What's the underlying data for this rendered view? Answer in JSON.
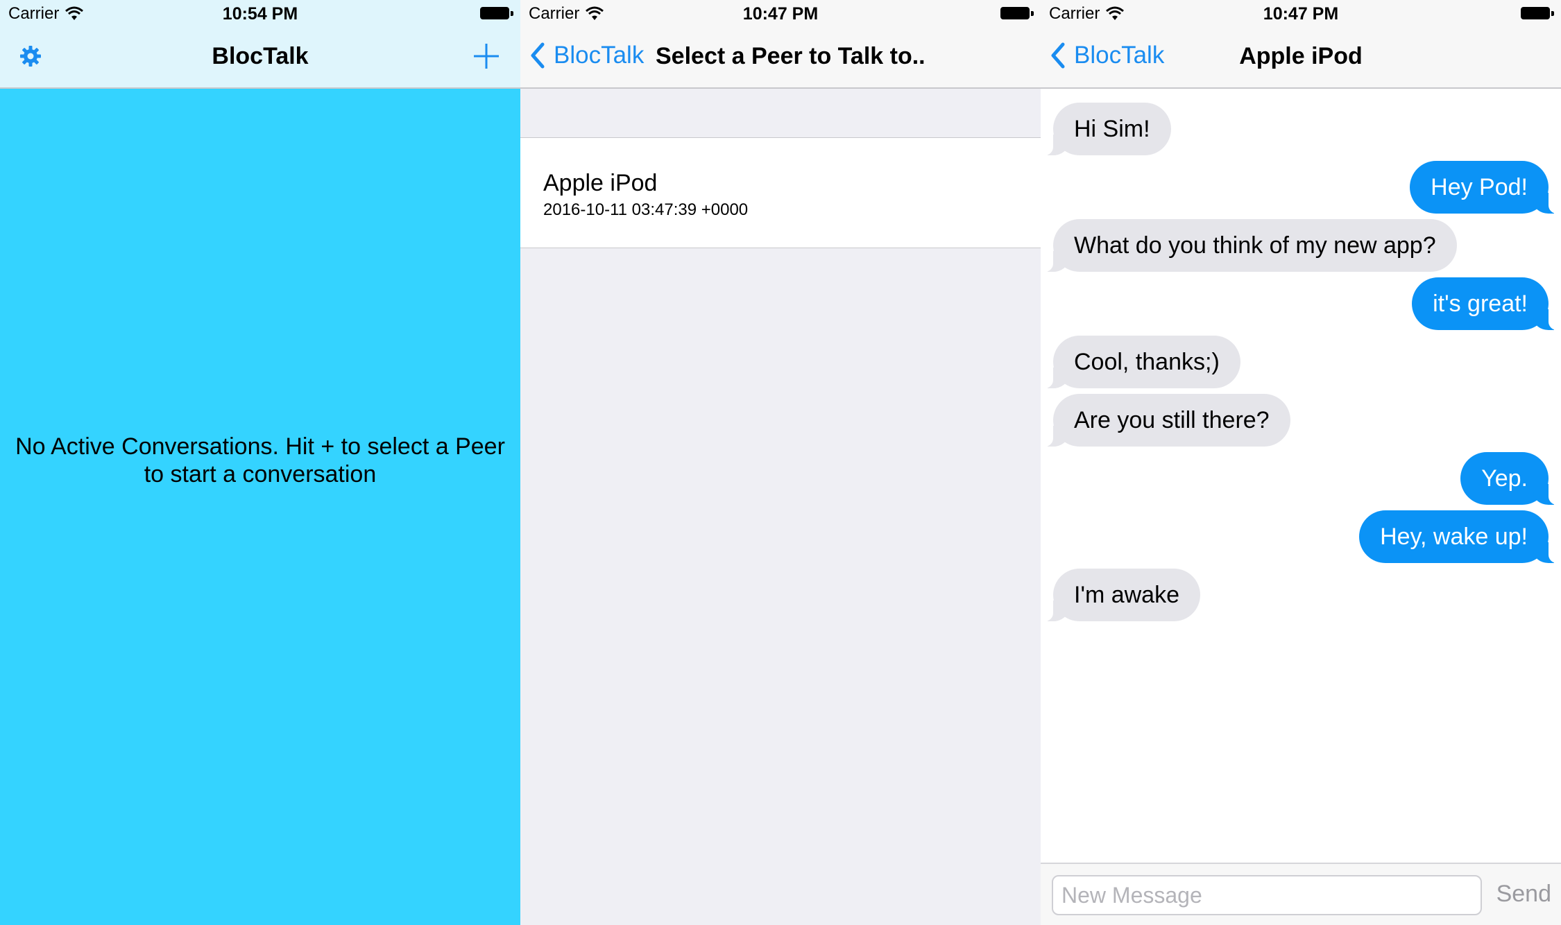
{
  "screens": [
    {
      "status": {
        "carrier": "Carrier",
        "time": "10:54 PM"
      },
      "nav": {
        "title": "BlocTalk",
        "left_icon": "gear-icon",
        "right_icon": "plus-icon"
      },
      "empty_message_line1": "No Active Conversations.  Hit + to select a Peer",
      "empty_message_line2": "to start a conversation",
      "colors": {
        "background": "#34d3ff",
        "navbar": "#dff5fc",
        "tint": "#1a8cf0"
      }
    },
    {
      "status": {
        "carrier": "Carrier",
        "time": "10:47 PM"
      },
      "nav": {
        "back_label": "BlocTalk",
        "title": "Select a Peer to Talk to.."
      },
      "peers": [
        {
          "name": "Apple iPod",
          "date": "2016-10-11 03:47:39 +0000"
        }
      ],
      "colors": {
        "background": "#efeff4"
      }
    },
    {
      "status": {
        "carrier": "Carrier",
        "time": "10:47 PM"
      },
      "nav": {
        "back_label": "BlocTalk",
        "title": "Apple iPod"
      },
      "messages": [
        {
          "text": "Hi Sim!",
          "direction": "incoming"
        },
        {
          "text": "Hey Pod!",
          "direction": "outgoing"
        },
        {
          "text": "What do you think of my new app?",
          "direction": "incoming"
        },
        {
          "text": "it's great!",
          "direction": "outgoing"
        },
        {
          "text": "Cool, thanks;)",
          "direction": "incoming"
        },
        {
          "text": "Are you still there?",
          "direction": "incoming"
        },
        {
          "text": "Yep.",
          "direction": "outgoing"
        },
        {
          "text": "Hey, wake up!",
          "direction": "outgoing"
        },
        {
          "text": "I'm awake",
          "direction": "incoming"
        }
      ],
      "composer": {
        "placeholder": "New Message",
        "value": "",
        "send_label": "Send"
      },
      "colors": {
        "incoming": "#e5e5ea",
        "outgoing": "#0b93f6"
      }
    }
  ]
}
